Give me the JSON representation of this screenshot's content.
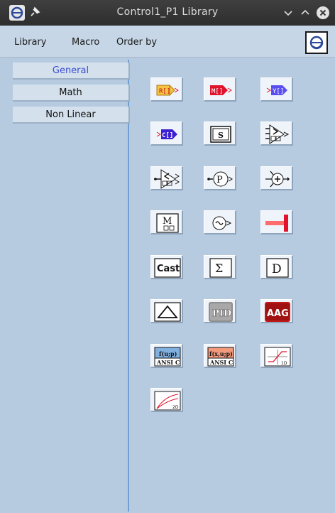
{
  "window": {
    "title": "Control1_P1 Library"
  },
  "titlebar_icons": [
    "app-logo-icon",
    "pin-icon",
    "minimize-icon",
    "maximize-icon",
    "close-icon"
  ],
  "menu": {
    "library": "Library",
    "macro": "Macro",
    "order_by": "Order by"
  },
  "categories": [
    {
      "label": "General",
      "selected": true
    },
    {
      "label": "Math"
    },
    {
      "label": "Non Linear"
    }
  ],
  "blocks": {
    "r_label": "R[]",
    "m_label": "M[]",
    "y_label": "Y[]",
    "c_label": "C[]",
    "s_label": "S",
    "p_label": "P",
    "m_block_label": "M",
    "cast_label": "Cast",
    "sigma_label": "Σ",
    "d_label": "D",
    "pid_label": "PID",
    "aag_label": "AAG",
    "fup_label": "f(u;p)",
    "fxup_label": "f(x,u;p)",
    "ansi_label": "ANSI C",
    "lut_1d_label": "1D",
    "lut_2d_label": "2D"
  },
  "colors": {
    "title_bg": "#333333",
    "panel_bg": "#b7cbe0",
    "selected_text": "#3b4ed0",
    "yellow_block": "#f5c243",
    "red_block": "#e0122c",
    "blue_block": "#5a4ef0",
    "aag_red": "#c01818"
  }
}
